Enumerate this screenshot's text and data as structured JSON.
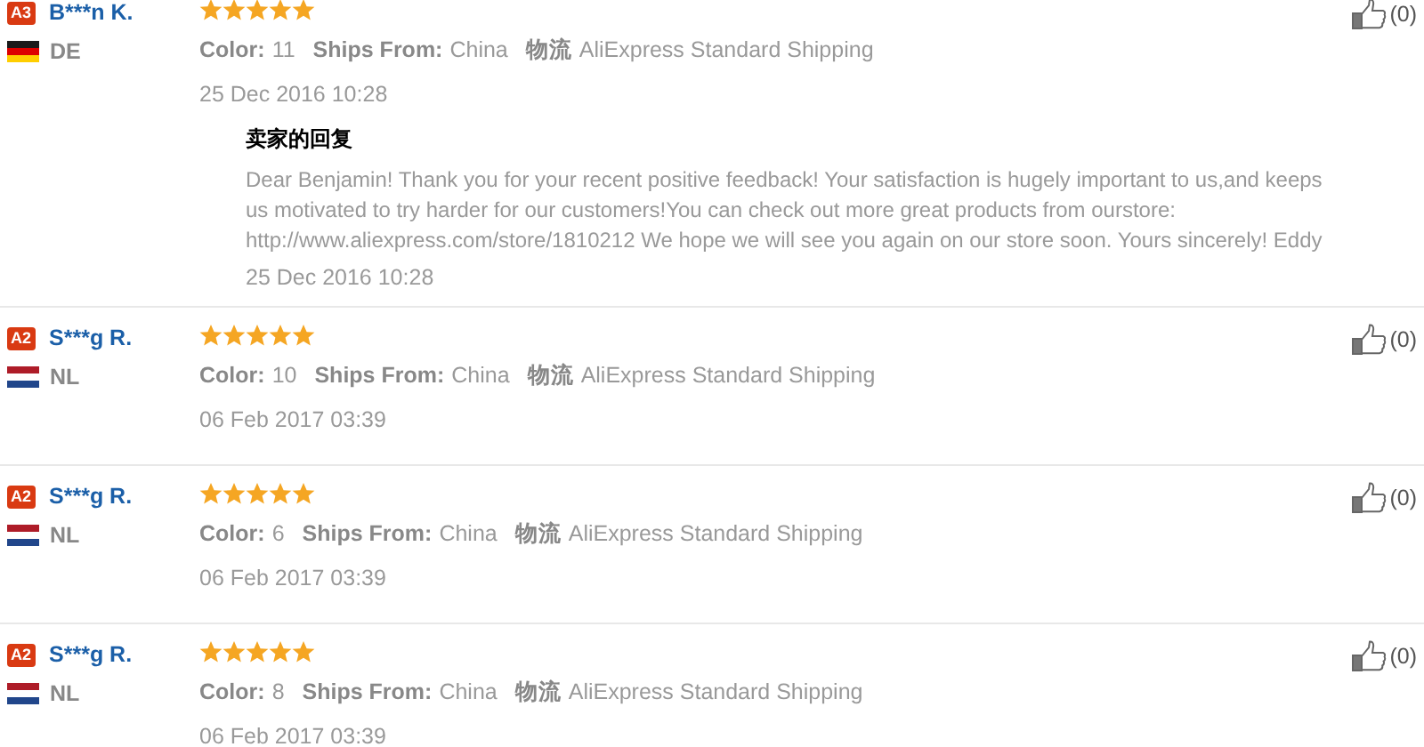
{
  "reviews": [
    {
      "badge": "A3",
      "name": "B***n K.",
      "flag": {
        "kind": "germany"
      },
      "country": "DE",
      "stars": 5,
      "attributes": [
        {
          "label": "Color:",
          "value": "11"
        },
        {
          "label": "Ships From:",
          "value": "China"
        },
        {
          "label": "物流",
          "value": "AliExpress Standard Shipping"
        }
      ],
      "date": "25 Dec 2016 10:28",
      "helpful": "(0)",
      "reply": {
        "title": "卖家的回复",
        "text": "Dear Benjamin! Thank you for your recent positive feedback! Your satisfaction is hugely important to us,and keeps us motivated to try harder for our customers!You can check out more great products from ourstore: http://www.aliexpress.com/store/1810212 We hope we will see you again on our store soon. Yours sincerely! Eddy",
        "date": "25 Dec 2016 10:28"
      }
    },
    {
      "badge": "A2",
      "name": "S***g R.",
      "flag": {
        "kind": "netherlands"
      },
      "country": "NL",
      "stars": 5,
      "attributes": [
        {
          "label": "Color:",
          "value": "10"
        },
        {
          "label": "Ships From:",
          "value": "China"
        },
        {
          "label": "物流",
          "value": "AliExpress Standard Shipping"
        }
      ],
      "date": "06 Feb 2017 03:39",
      "helpful": "(0)"
    },
    {
      "badge": "A2",
      "name": "S***g R.",
      "flag": {
        "kind": "netherlands"
      },
      "country": "NL",
      "stars": 5,
      "attributes": [
        {
          "label": "Color:",
          "value": "6"
        },
        {
          "label": "Ships From:",
          "value": "China"
        },
        {
          "label": "物流",
          "value": "AliExpress Standard Shipping"
        }
      ],
      "date": "06 Feb 2017 03:39",
      "helpful": "(0)"
    },
    {
      "badge": "A2",
      "name": "S***g R.",
      "flag": {
        "kind": "netherlands"
      },
      "country": "NL",
      "stars": 5,
      "attributes": [
        {
          "label": "Color:",
          "value": "8"
        },
        {
          "label": "Ships From:",
          "value": "China"
        },
        {
          "label": "物流",
          "value": "AliExpress Standard Shipping"
        }
      ],
      "date": "06 Feb 2017 03:39",
      "helpful": "(0)"
    }
  ]
}
